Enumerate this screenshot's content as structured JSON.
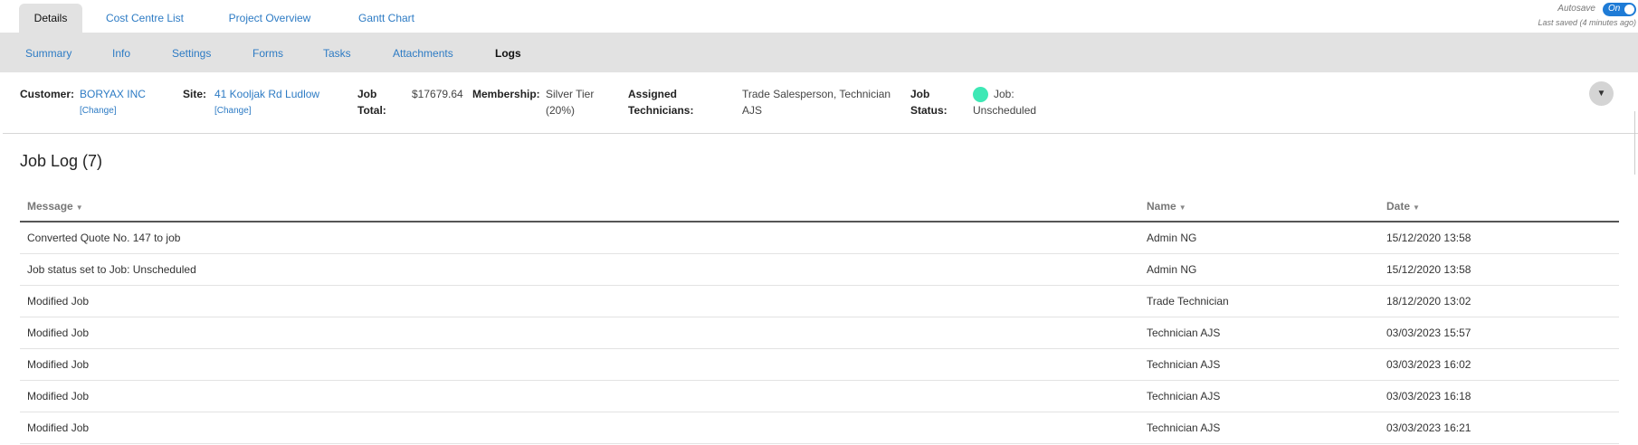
{
  "top_tabs": [
    {
      "label": "Details",
      "active": true
    },
    {
      "label": "Cost Centre List"
    },
    {
      "label": "Project Overview"
    },
    {
      "label": "Gantt Chart"
    }
  ],
  "autosave": {
    "label": "Autosave",
    "toggle": "On",
    "last_saved": "Last saved (4 minutes ago)"
  },
  "sub_tabs": [
    {
      "label": "Summary"
    },
    {
      "label": "Info"
    },
    {
      "label": "Settings"
    },
    {
      "label": "Forms"
    },
    {
      "label": "Tasks"
    },
    {
      "label": "Attachments"
    },
    {
      "label": "Logs",
      "active": true
    }
  ],
  "summary": {
    "customer_label": "Customer:",
    "customer_value": "BORYAX INC",
    "customer_change": "[Change]",
    "site_label": "Site:",
    "site_value": "41 Kooljak Rd Ludlow",
    "site_change": "[Change]",
    "job_total_label_1": "Job",
    "job_total_label_2": "Total:",
    "job_total_value": "$17679.64",
    "membership_label": "Membership:",
    "membership_value_1": "Silver Tier",
    "membership_value_2": "(20%)",
    "technicians_label_1": "Assigned",
    "technicians_label_2": "Technicians:",
    "technicians_value_1": "Trade Salesperson, Technician",
    "technicians_value_2": "AJS",
    "status_label_1": "Job",
    "status_label_2": "Status:",
    "status_value_1": "Job:",
    "status_value_2": "Unscheduled",
    "status_color": "#3ee8b5",
    "expand_icon": "▼"
  },
  "job_log": {
    "title": "Job Log (7)",
    "columns": {
      "message": "Message",
      "name": "Name",
      "date": "Date"
    },
    "sort_icon": "▼",
    "rows": [
      {
        "message": "Converted Quote No. 147 to job",
        "name": "Admin NG",
        "date": "15/12/2020 13:58"
      },
      {
        "message": "Job status set to Job: Unscheduled",
        "name": "Admin NG",
        "date": "15/12/2020 13:58"
      },
      {
        "message": "Modified Job",
        "name": "Trade Technician",
        "date": "18/12/2020 13:02"
      },
      {
        "message": "Modified Job",
        "name": "Technician AJS",
        "date": "03/03/2023 15:57"
      },
      {
        "message": "Modified Job",
        "name": "Technician AJS",
        "date": "03/03/2023 16:02"
      },
      {
        "message": "Modified Job",
        "name": "Technician AJS",
        "date": "03/03/2023 16:18"
      },
      {
        "message": "Modified Job",
        "name": "Technician AJS",
        "date": "03/03/2023 16:21"
      }
    ]
  }
}
